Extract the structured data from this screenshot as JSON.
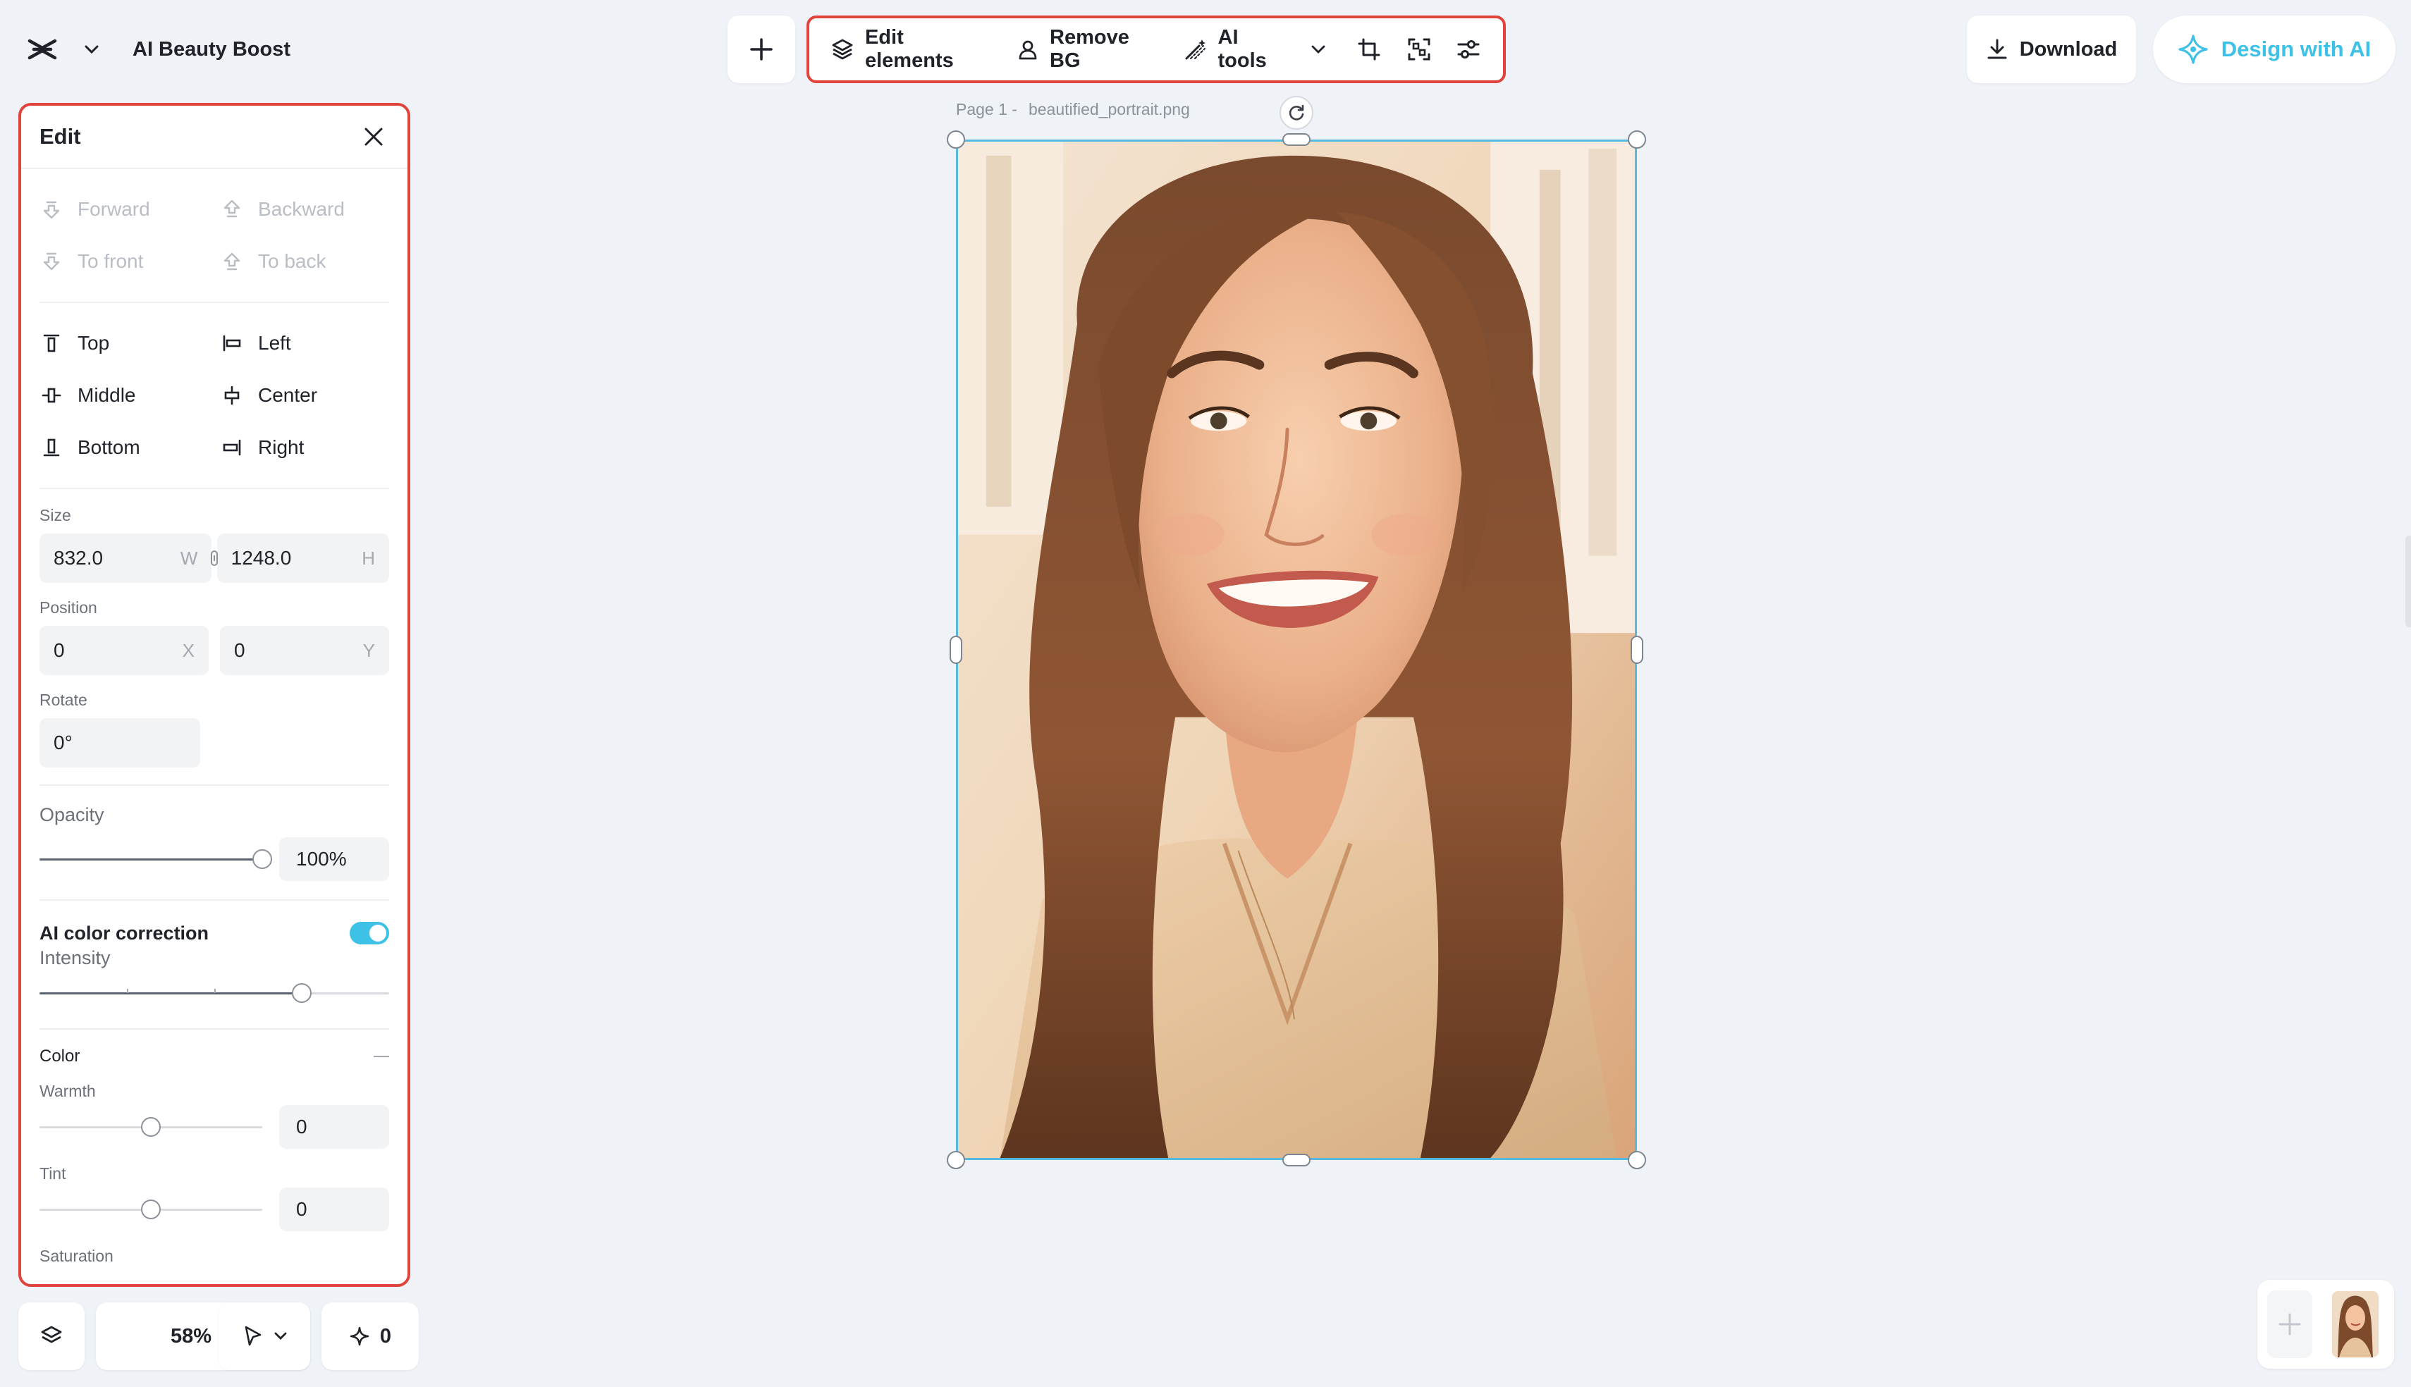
{
  "app": {
    "project_name": "AI Beauty Boost"
  },
  "toolbar": {
    "edit_elements": "Edit elements",
    "remove_bg": "Remove BG",
    "ai_tools": "AI tools"
  },
  "header_right": {
    "download": "Download",
    "design_with_ai": "Design with AI"
  },
  "panel": {
    "title": "Edit",
    "arrange": {
      "forward": "Forward",
      "backward": "Backward",
      "to_front": "To front",
      "to_back": "To back"
    },
    "align": {
      "top": "Top",
      "left": "Left",
      "middle": "Middle",
      "center": "Center",
      "bottom": "Bottom",
      "right": "Right"
    },
    "size": {
      "label": "Size",
      "width": "832.0",
      "width_suffix": "W",
      "height": "1248.0",
      "height_suffix": "H"
    },
    "position": {
      "label": "Position",
      "x": "0",
      "x_suffix": "X",
      "y": "0",
      "y_suffix": "Y"
    },
    "rotate": {
      "label": "Rotate",
      "value": "0°"
    },
    "opacity": {
      "label": "Opacity",
      "value": "100%",
      "level": 1.0
    },
    "ai_color_correction": {
      "label": "AI color correction",
      "enabled": true,
      "intensity_label": "Intensity",
      "intensity_level": 0.75
    },
    "color": {
      "label": "Color",
      "warmth_label": "Warmth",
      "warmth_value": "0",
      "warmth_level": 0.5,
      "tint_label": "Tint",
      "tint_value": "0",
      "tint_level": 0.5,
      "saturation_label": "Saturation"
    }
  },
  "bottom_bar": {
    "zoom": "58%",
    "credits": "0"
  },
  "canvas": {
    "page_label": "Page 1 -",
    "file_name": "beautified_portrait.png"
  },
  "colors": {
    "accent": "#3ec1e6",
    "highlight_border": "#e0443c",
    "selection": "#57b9dd",
    "background": "#eff2f6"
  },
  "icons": {
    "logo": "capcut-logo-icon",
    "layers": "layers-icon",
    "cursor": "pointer-icon",
    "sparkle": "sparkle-icon"
  }
}
